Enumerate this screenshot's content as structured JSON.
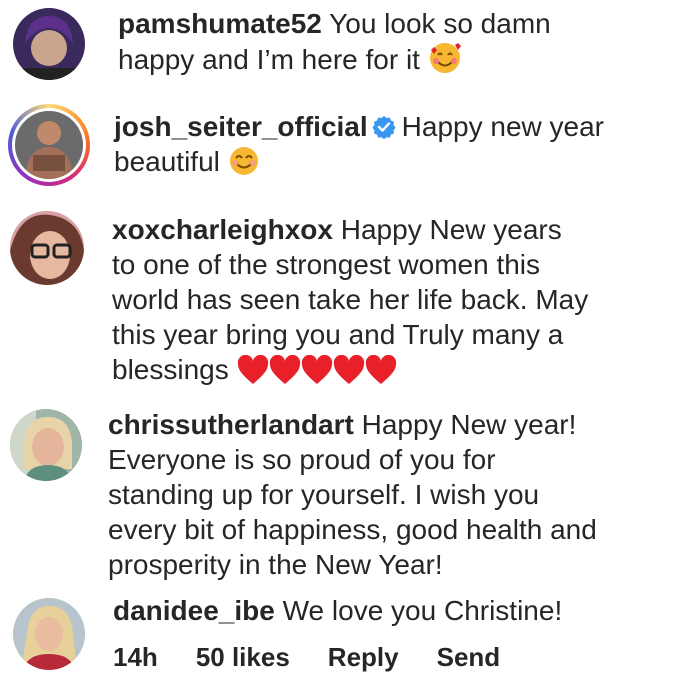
{
  "comments": [
    {
      "username": "pamshumate52",
      "lines": [
        "You look so damn",
        "happy and I’m here for it"
      ],
      "emoji": "smiling-face-with-hearts-icon"
    },
    {
      "username": "josh_seiter_official",
      "verified": true,
      "lines": [
        "Happy new year",
        "beautiful"
      ],
      "emoji": "smiling-face-with-smiling-eyes-icon"
    },
    {
      "username": "xoxcharleighxox",
      "lines": [
        "Happy New years",
        "to one of the strongest women this",
        "world has seen take her life back. May",
        "this year bring you and Truly many a",
        "blessings"
      ],
      "emoji": "red-heart-icon"
    },
    {
      "username": "chrissutherlandart",
      "lines": [
        "Happy New year!",
        "Everyone is so proud of you for",
        "standing up for yourself. I wish you",
        "every bit of happiness, good health and",
        "prosperity in the New Year!"
      ]
    },
    {
      "username": "danidee_ibe",
      "lines": [
        "We love you Christine!"
      ]
    }
  ],
  "meta": {
    "time": "14h",
    "likes": "50 likes",
    "reply": "Reply",
    "send": "Send"
  },
  "colors": {
    "text": "#262626",
    "verified": "#3897f0",
    "heart": "#e8202a"
  }
}
